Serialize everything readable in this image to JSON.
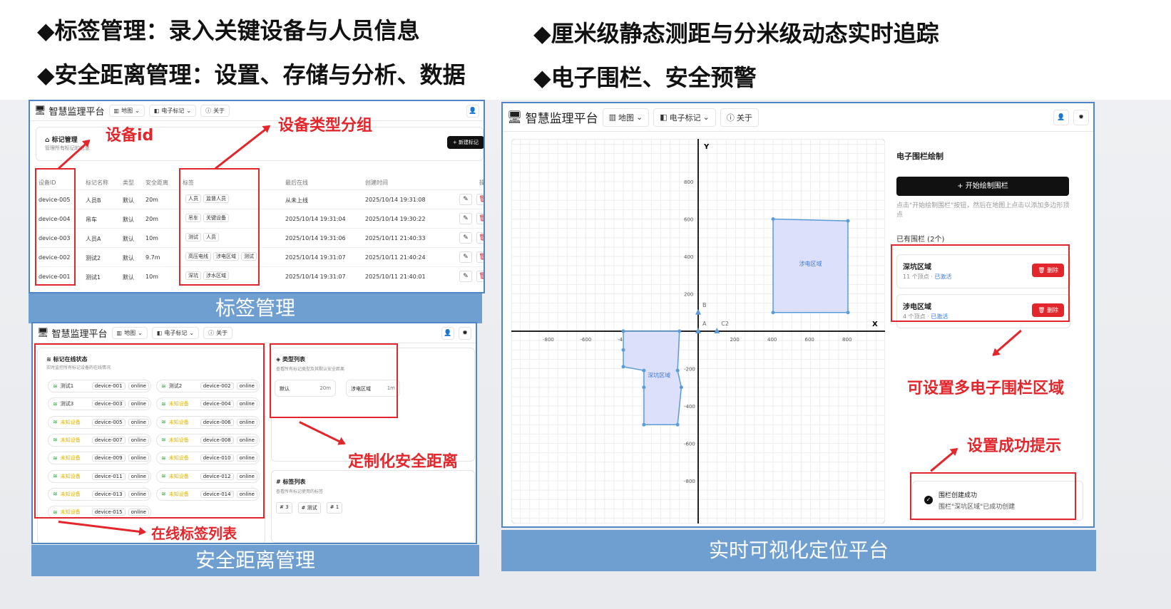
{
  "headlines": {
    "h1": "标签管理：录入关键设备与人员信息",
    "h2": "安全距离管理：设置、存储与分析、数据",
    "h3": "厘米级静态测距与分米级动态实时追踪",
    "h4": "电子围栏、安全预警",
    "bullet": "◆"
  },
  "app": {
    "brand": "智慧监理平台",
    "nav_map": "地图",
    "nav_marks": "电子标记",
    "nav_about": "关于"
  },
  "tagPanel": {
    "title": "标记管理",
    "subtitle": "管理所有标记的信息",
    "new_btn": "+ 新建标记",
    "headers": [
      "设备ID",
      "标记名称",
      "类型",
      "安全距离",
      "标签",
      "最后在线",
      "创建时间",
      "操"
    ],
    "rows": [
      {
        "id": "device-005",
        "name": "人员B",
        "type": "默认",
        "dist": "20m",
        "tags": [
          "人员",
          "监督人员"
        ],
        "last": "从未上线",
        "created": "2025/10/14 19:31:08"
      },
      {
        "id": "device-004",
        "name": "吊车",
        "type": "默认",
        "dist": "20m",
        "tags": [
          "吊车",
          "关键设备"
        ],
        "last": "2025/10/14 19:31:04",
        "created": "2025/10/14 19:30:22"
      },
      {
        "id": "device-003",
        "name": "人员A",
        "type": "默认",
        "dist": "10m",
        "tags": [
          "测试",
          "人员"
        ],
        "last": "2025/10/14 19:31:06",
        "created": "2025/10/11 21:40:33"
      },
      {
        "id": "device-002",
        "name": "测试2",
        "type": "默认",
        "dist": "9.7m",
        "tags": [
          "高压电线",
          "涉电区域",
          "测试"
        ],
        "last": "2025/10/14 19:31:07",
        "created": "2025/10/11 21:40:24"
      },
      {
        "id": "device-001",
        "name": "测试1",
        "type": "默认",
        "dist": "10m",
        "tags": [
          "深坑",
          "涉水区域"
        ],
        "last": "2025/10/14 19:31:07",
        "created": "2025/10/11 21:40:01"
      }
    ],
    "caption": "标签管理",
    "ann_id": "设备id",
    "ann_group": "设备类型分组"
  },
  "onlinePanel": {
    "title": "标记在线状态",
    "subtitle": "实时监控所有标记设备的在线情况",
    "items": [
      {
        "name": "测试1",
        "id": "device-001",
        "st": "online",
        "unknown": false
      },
      {
        "name": "测试2",
        "id": "device-002",
        "st": "online",
        "unknown": false
      },
      {
        "name": "测试3",
        "id": "device-003",
        "st": "online",
        "unknown": false
      },
      {
        "name": "未知设备",
        "id": "device-004",
        "st": "online",
        "unknown": true
      },
      {
        "name": "未知设备",
        "id": "device-005",
        "st": "online",
        "unknown": true
      },
      {
        "name": "未知设备",
        "id": "device-006",
        "st": "online",
        "unknown": true
      },
      {
        "name": "未知设备",
        "id": "device-007",
        "st": "online",
        "unknown": true
      },
      {
        "name": "未知设备",
        "id": "device-008",
        "st": "online",
        "unknown": true
      },
      {
        "name": "未知设备",
        "id": "device-009",
        "st": "online",
        "unknown": true
      },
      {
        "name": "未知设备",
        "id": "device-010",
        "st": "online",
        "unknown": true
      },
      {
        "name": "未知设备",
        "id": "device-011",
        "st": "online",
        "unknown": true
      },
      {
        "name": "未知设备",
        "id": "device-012",
        "st": "online",
        "unknown": true
      },
      {
        "name": "未知设备",
        "id": "device-013",
        "st": "online",
        "unknown": true
      },
      {
        "name": "未知设备",
        "id": "device-014",
        "st": "online",
        "unknown": true
      },
      {
        "name": "未知设备",
        "id": "device-015",
        "st": "online",
        "unknown": true
      }
    ],
    "typeTitle": "类型列表",
    "typeSub": "查看所有标记类型及其默认安全距离",
    "types": [
      {
        "n": "默认",
        "v": "20m"
      },
      {
        "n": "涉电区域",
        "v": "1m"
      }
    ],
    "tagTitle": "标签列表",
    "tagSub": "查看所有标记使用的标签",
    "tagChips": [
      "# 3",
      "# 测试",
      "# 1"
    ],
    "caption": "安全距离管理",
    "ann_custom": "定制化安全距离",
    "ann_list": "在线标签列表"
  },
  "mapPanel": {
    "fenceTitle": "电子围栏绘制",
    "startBtn": "+ 开始绘制围栏",
    "hint": "点击\"开始绘制围栏\"按钮，然后在地图上点击以添加多边形顶点",
    "existing": "已有围栏 (2个)",
    "fences": [
      {
        "name": "深坑区域",
        "info": "11 个顶点 · ",
        "status": "已激活",
        "del": "删除"
      },
      {
        "name": "涉电区域",
        "info": "4 个顶点 · ",
        "status": "已激活",
        "del": "删除"
      }
    ],
    "toastTitle": "围栏创建成功",
    "toastMsg": "围栏\"深坑区域\"已成功创建",
    "caption": "实时可视化定位平台",
    "ann_multi": "可设置多电子围栏区域",
    "ann_ok": "设置成功提示",
    "axis_x": "X",
    "axis_y": "Y",
    "xticks": [
      "-800",
      "-600",
      "-400",
      "-200",
      "200",
      "400",
      "600",
      "800"
    ],
    "yticks": [
      "800",
      "600",
      "400",
      "200",
      "-200",
      "-400",
      "-600",
      "-800"
    ],
    "zone1": "涉电区域",
    "zone2": "深坑区域",
    "anchors": [
      "A",
      "B",
      "C2"
    ],
    "colors": {
      "zone": "#5b9bd8",
      "zoneFill": "#dde0fb"
    }
  }
}
